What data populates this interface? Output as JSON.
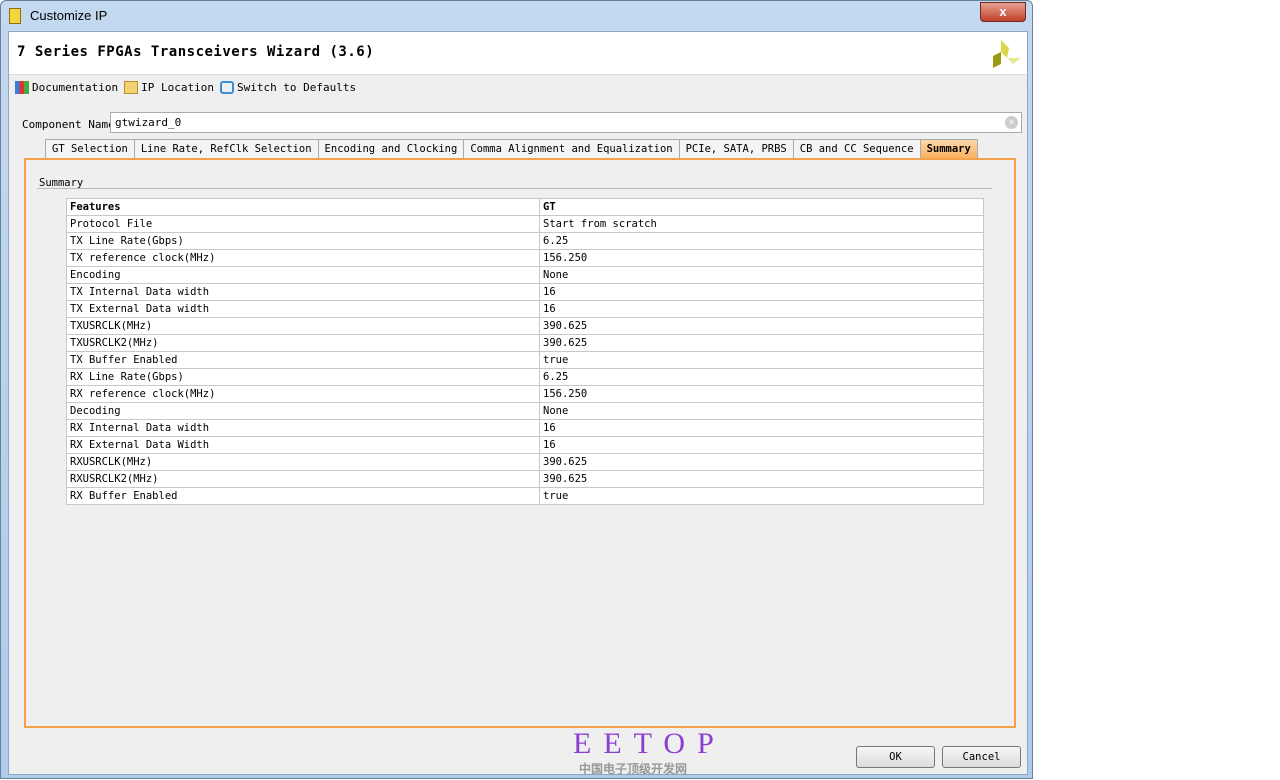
{
  "window": {
    "title": "Customize IP",
    "close": "x"
  },
  "header": {
    "title": "7 Series FPGAs Transceivers Wizard (3.6)"
  },
  "toolbar": {
    "documentation": "Documentation",
    "ip_location": "IP Location",
    "switch_defaults": "Switch to Defaults"
  },
  "component": {
    "label": "Component Name",
    "value": "gtwizard_0"
  },
  "tabs": [
    "GT Selection",
    "Line Rate, RefClk Selection",
    "Encoding and Clocking",
    "Comma Alignment and Equalization",
    "PCIe, SATA, PRBS",
    "CB and CC Sequence",
    "Summary"
  ],
  "summary": {
    "label": "Summary",
    "header": [
      "Features",
      "GT"
    ],
    "rows": [
      [
        "Protocol File",
        "Start from scratch"
      ],
      [
        "TX Line Rate(Gbps)",
        "6.25"
      ],
      [
        "TX reference clock(MHz)",
        "156.250"
      ],
      [
        "Encoding",
        "None"
      ],
      [
        "TX Internal Data width",
        "16"
      ],
      [
        "TX External Data width",
        "16"
      ],
      [
        "TXUSRCLK(MHz)",
        "390.625"
      ],
      [
        "TXUSRCLK2(MHz)",
        "390.625"
      ],
      [
        "TX Buffer Enabled",
        "true"
      ],
      [
        "RX Line Rate(Gbps)",
        "6.25"
      ],
      [
        "RX reference clock(MHz)",
        "156.250"
      ],
      [
        "Decoding",
        "None"
      ],
      [
        "RX Internal Data width",
        "16"
      ],
      [
        "RX External Data Width",
        "16"
      ],
      [
        "RXUSRCLK(MHz)",
        "390.625"
      ],
      [
        "RXUSRCLK2(MHz)",
        "390.625"
      ],
      [
        "RX Buffer Enabled",
        "true"
      ]
    ]
  },
  "buttons": {
    "ok": "OK",
    "cancel": "Cancel"
  },
  "watermark": {
    "brand": "EETOP",
    "subtitle": "中国电子顶级开发网"
  }
}
